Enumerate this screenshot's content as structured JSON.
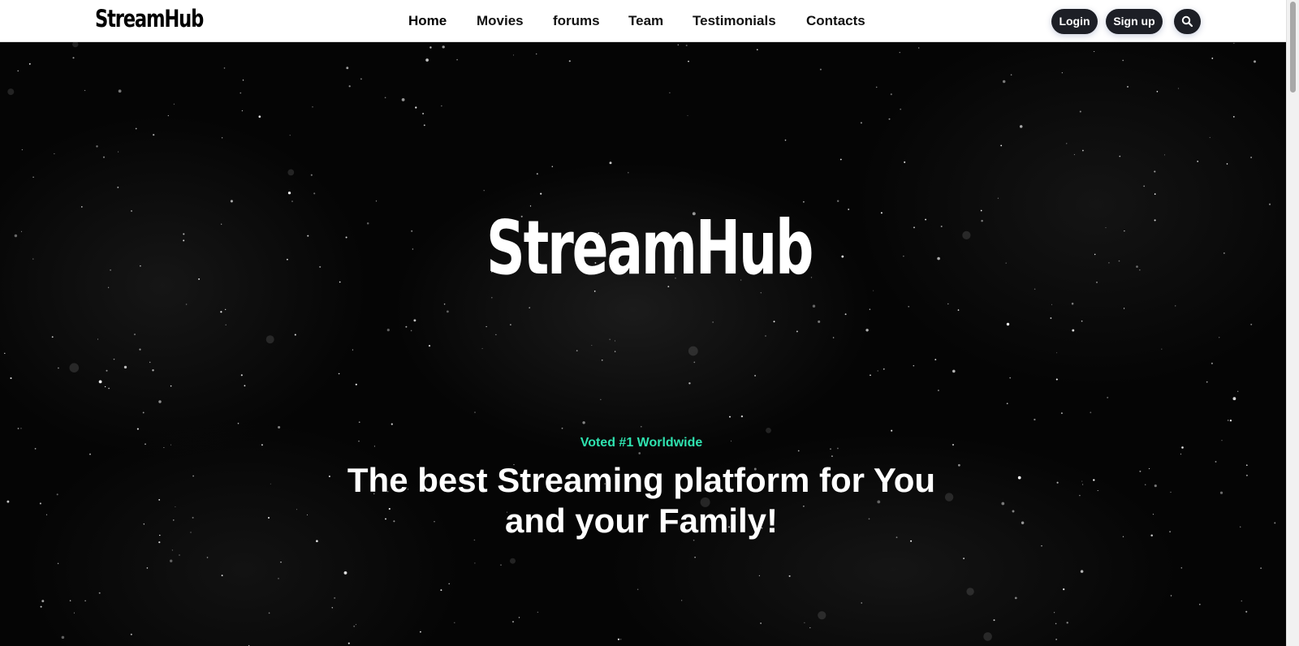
{
  "header": {
    "brand": "StreamHub",
    "nav": {
      "home": "Home",
      "movies": "Movies",
      "forums": "forums",
      "team": "Team",
      "testimonials": "Testimonials",
      "contacts": "Contacts"
    },
    "login_label": "Login",
    "signup_label": "Sign up",
    "search_icon": "search-icon"
  },
  "hero": {
    "title": "StreamHub",
    "eyebrow": "Voted #1 Worldwide",
    "headline": "The best Streaming platform for You and your Family!",
    "background": "starfield"
  },
  "colors": {
    "accent": "#2fe3b0",
    "nav_bg": "#ffffff",
    "button_bg": "#1d1f26",
    "hero_bg": "#050505"
  }
}
